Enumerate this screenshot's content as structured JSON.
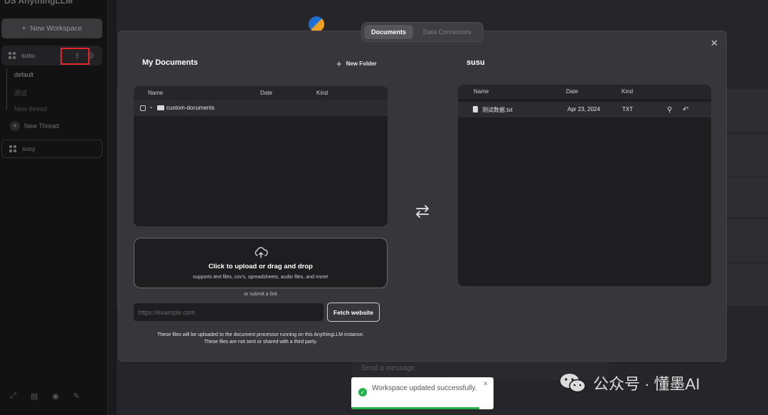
{
  "background": {
    "brand_title": "DS AnythingLLM",
    "new_workspace_label": "New Workspace",
    "workspaces": [
      {
        "name": "susu"
      },
      {
        "name": "susy"
      }
    ],
    "threads": [
      "default",
      "测试",
      "New thread"
    ],
    "new_thread_label": "New Thread",
    "send_placeholder": "Send a message"
  },
  "modal": {
    "tabs": [
      {
        "label": "Documents",
        "active": true
      },
      {
        "label": "Data Connectors",
        "active": false
      }
    ],
    "my_documents": {
      "title": "My Documents",
      "new_folder_label": "New Folder",
      "columns": [
        "Name",
        "Date",
        "Kind"
      ],
      "rows": [
        {
          "name": "custom-documents",
          "type": "folder"
        }
      ]
    },
    "workspace_panel": {
      "title": "susu",
      "columns": [
        "Name",
        "Date",
        "Kind"
      ],
      "rows": [
        {
          "name": "测试数据.txt",
          "date": "Apr 23, 2024",
          "kind": "TXT"
        }
      ]
    },
    "upload": {
      "title": "Click to upload or drag and drop",
      "subtitle": "supports text files, csv's, spreadsheets, audio files, and more!",
      "or_link": "or submit a link",
      "url_placeholder": "https://example.com",
      "fetch_label": "Fetch website",
      "disclaimer_line1": "These files will be uploaded to the document processor running on this AnythingLLM instance.",
      "disclaimer_line2": "These files are not sent or shared with a third party."
    }
  },
  "toast": {
    "message": "Workspace updated successfully.",
    "progress": 0.9,
    "color": "#21b34a"
  },
  "watermark": {
    "text": "公众号 · 懂墨AI"
  },
  "colors": {
    "modal_bg": "#37373b",
    "panel_bg": "#1e1e20",
    "highlight": "#e0262a"
  }
}
